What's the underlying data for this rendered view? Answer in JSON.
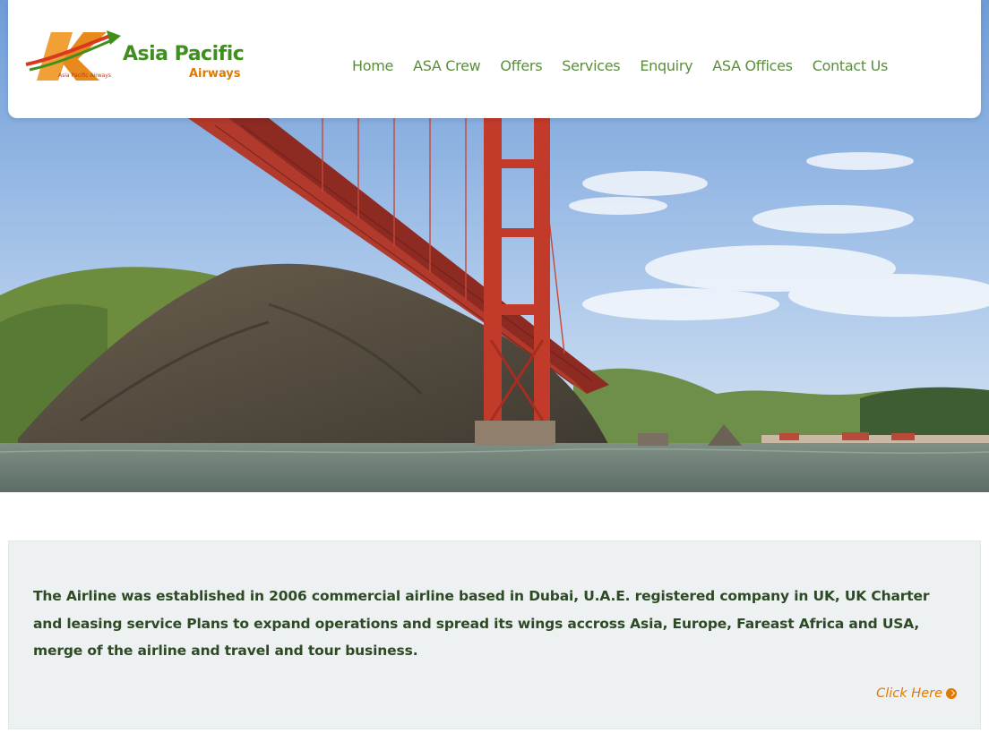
{
  "brand": {
    "name": "Asia Pacific",
    "sub": "Airways",
    "tiny": "Asia Pacific Airways",
    "colors": {
      "green": "#3f8f1f",
      "orange": "#e07a00",
      "red": "#c23b1a"
    }
  },
  "nav": {
    "items": [
      {
        "label": "Home"
      },
      {
        "label": "ASA Crew"
      },
      {
        "label": "Offers"
      },
      {
        "label": "Services"
      },
      {
        "label": "Enquiry"
      },
      {
        "label": "ASA Offices"
      },
      {
        "label": "Contact Us"
      }
    ]
  },
  "hero": {
    "image": "golden-gate-bridge-photo"
  },
  "about": {
    "text": "The Airline was established in 2006 commercial airline based in Dubai, U.A.E. registered company in UK, UK Charter and leasing service Plans to expand operations and spread its wings accross Asia, Europe, Fareast Africa and USA, merge of the airline and travel and tour business.",
    "cta_label": "Click Here",
    "cta_icon": "chevron-circle-right-icon"
  }
}
